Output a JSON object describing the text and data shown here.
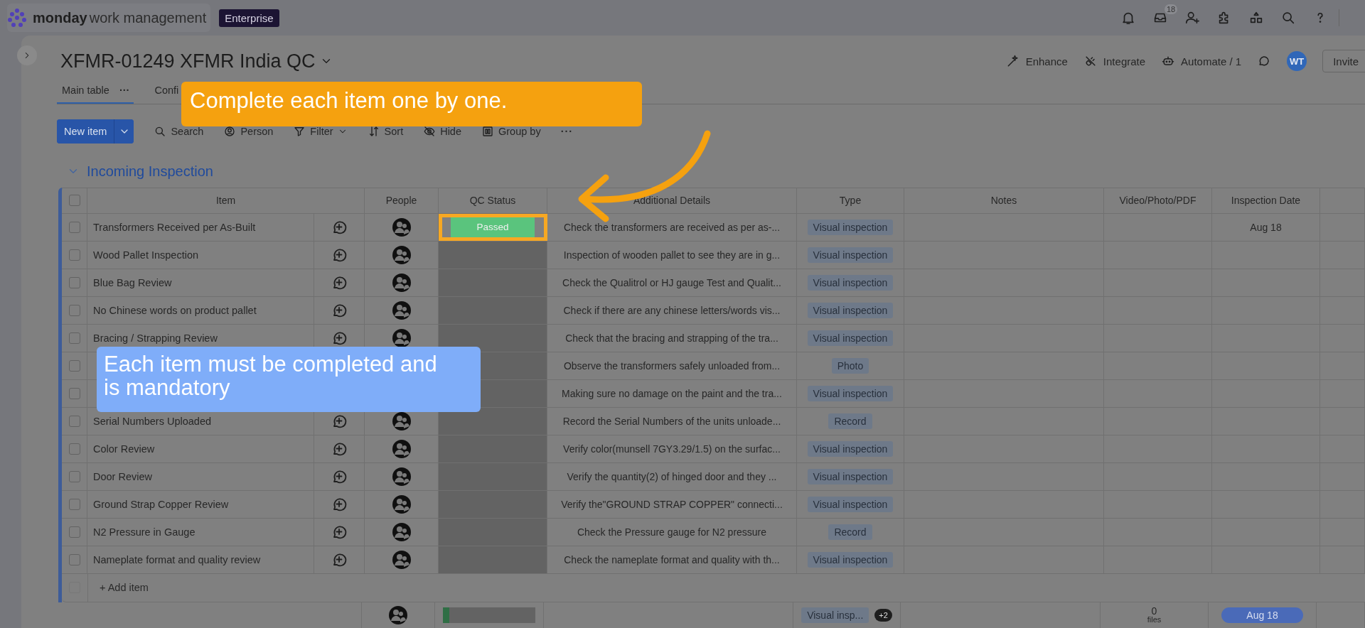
{
  "app": {
    "logo": "monday",
    "product": "work management",
    "plan_badge": "Enterprise",
    "inbox_count": "18"
  },
  "board": {
    "title": "XFMR-01249 XFMR India QC",
    "actions": [
      {
        "label": "Enhance",
        "kind": "enhance"
      },
      {
        "label": "Integrate",
        "kind": "integrate"
      },
      {
        "label": "Automate / 1",
        "kind": "automate"
      }
    ],
    "avatar": "WT",
    "invite": "Invite"
  },
  "views": [
    {
      "label": "Main table",
      "more": "···",
      "selected": true
    },
    {
      "label": "Confi",
      "selected": false
    }
  ],
  "toolbar": {
    "new_item": "New item",
    "tools": [
      {
        "label": "Search",
        "kind": "search"
      },
      {
        "label": "Person",
        "kind": "person"
      },
      {
        "label": "Filter",
        "kind": "filter"
      },
      {
        "label": "Sort",
        "kind": "sort"
      },
      {
        "label": "Hide",
        "kind": "hide"
      },
      {
        "label": "Group by",
        "kind": "group"
      },
      {
        "label": "···",
        "kind": "more"
      }
    ]
  },
  "group": {
    "title": "Incoming Inspection",
    "columns": [
      "Item",
      "People",
      "QC Status",
      "Additional Details",
      "Type",
      "Notes",
      "Video/Photo/PDF",
      "Inspection Date"
    ],
    "rows": [
      {
        "item": "Transformers Received per As-Built",
        "checked": false,
        "status": "Passed",
        "highlighted": true,
        "details": "Check the transformers are received as per as-...",
        "type": "Visual inspection",
        "date": "Aug 18"
      },
      {
        "item": "Wood Pallet Inspection",
        "checked": false,
        "highlighted": false,
        "details": "Inspection of wooden pallet to see they are in g...",
        "type": "Visual inspection"
      },
      {
        "item": "Blue Bag Review",
        "checked": false,
        "highlighted": false,
        "details": "Check the Qualitrol or HJ gauge Test and Qualit...",
        "type": "Visual inspection"
      },
      {
        "item": "No Chinese words on product pallet",
        "checked": false,
        "highlighted": false,
        "details": "Check if there are any chinese letters/words vis...",
        "type": "Visual inspection"
      },
      {
        "item": "Bracing / Strapping Review",
        "checked": false,
        "highlighted": false,
        "details": "Check that the bracing and strapping of the tra...",
        "type": "Visual inspection"
      },
      {
        "checked": false,
        "highlighted": false,
        "details": "Observe the transformers safely unloaded from...",
        "type": "Photo"
      },
      {
        "checked": false,
        "highlighted": false,
        "details": "Making sure no damage on the paint and the tra...",
        "type": "Visual inspection"
      },
      {
        "item": "Serial Numbers Uploaded",
        "checked": false,
        "highlighted": false,
        "details": "Record the Serial Numbers of the units unloade...",
        "type": "Record"
      },
      {
        "item": "Color Review",
        "checked": false,
        "highlighted": false,
        "details": "Verify color(munsell 7GY3.29/1.5) on the surfac...",
        "type": "Visual inspection"
      },
      {
        "item": "Door Review",
        "checked": false,
        "highlighted": false,
        "details": "Verify the quantity(2) of hinged door and they ...",
        "type": "Visual inspection"
      },
      {
        "item": "Ground Strap Copper Review",
        "checked": false,
        "highlighted": false,
        "details": "Verify the\"GROUND STRAP COPPER\" connecti...",
        "type": "Visual inspection"
      },
      {
        "item": "N2 Pressure in Gauge",
        "checked": false,
        "highlighted": false,
        "details": "Check the Pressure gauge for N2 pressure",
        "type": "Record"
      },
      {
        "item": "Nameplate format and quality review",
        "checked": false,
        "highlighted": false,
        "details": "Check the nameplate format and quality with th...",
        "type": "Visual inspection"
      }
    ],
    "add_item": "+ Add item",
    "select_all_checked": false,
    "add_row_checked": false,
    "footer": {
      "status_progress": {
        "level": 0.07
      },
      "type_summary": "Visual insp...",
      "type_more": "+2",
      "files_count": "0",
      "files_label": "files",
      "date": "Aug 18"
    }
  },
  "callouts": [
    {
      "text": "Complete each item one by one.",
      "color": "#f5a10f",
      "kind": "arrow"
    },
    {
      "text": "Each item must be completed and is mandatory",
      "color": "#7fadf9",
      "kind": "plain"
    }
  ]
}
